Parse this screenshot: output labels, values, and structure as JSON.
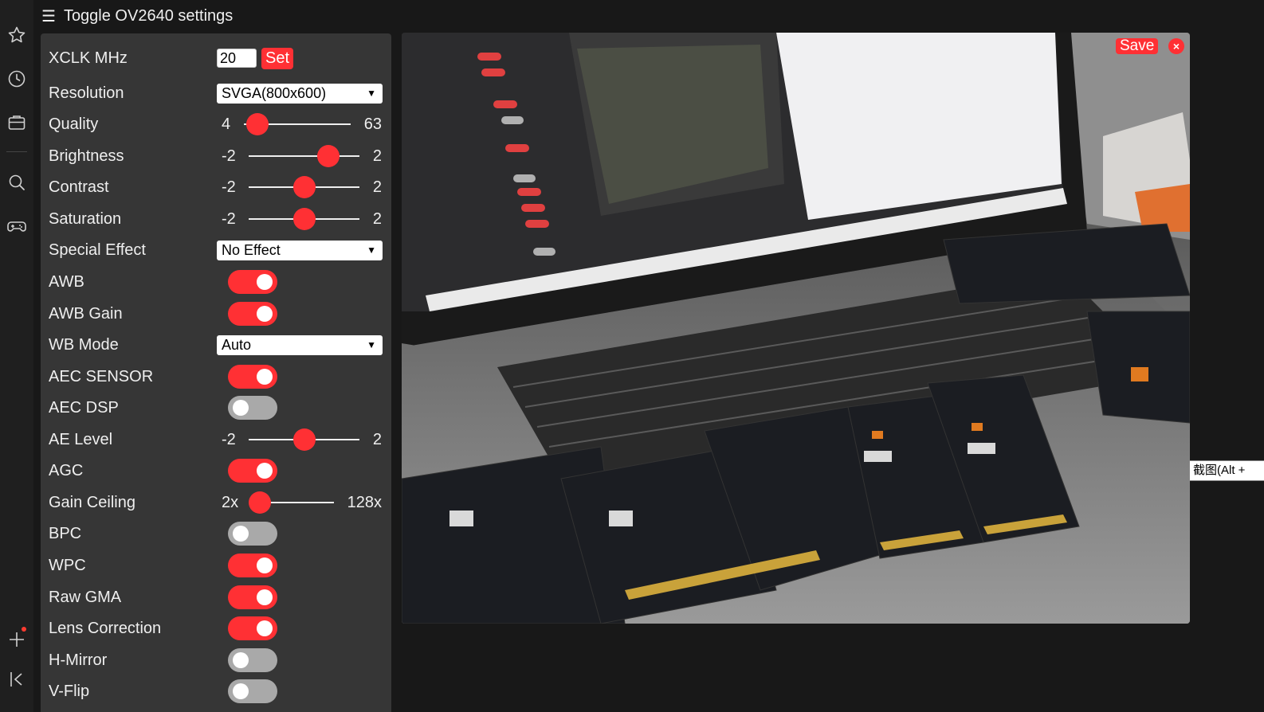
{
  "toggle_label": "Toggle OV2640 settings",
  "settings": {
    "xclk": {
      "label": "XCLK MHz",
      "value": "20",
      "button": "Set"
    },
    "resolution": {
      "label": "Resolution",
      "selected": "SVGA(800x600)"
    },
    "quality": {
      "label": "Quality",
      "min": "4",
      "max": "63",
      "level": 0.08
    },
    "brightness": {
      "label": "Brightness",
      "min": "-2",
      "max": "2",
      "level": 0.75
    },
    "contrast": {
      "label": "Contrast",
      "min": "-2",
      "max": "2",
      "level": 0.5
    },
    "saturation": {
      "label": "Saturation",
      "min": "-2",
      "max": "2",
      "level": 0.5
    },
    "special_effect": {
      "label": "Special Effect",
      "selected": "No Effect"
    },
    "awb": {
      "label": "AWB",
      "on": true
    },
    "awb_gain": {
      "label": "AWB Gain",
      "on": true
    },
    "wb_mode": {
      "label": "WB Mode",
      "selected": "Auto"
    },
    "aec_sensor": {
      "label": "AEC SENSOR",
      "on": true
    },
    "aec_dsp": {
      "label": "AEC DSP",
      "on": false
    },
    "ae_level": {
      "label": "AE Level",
      "min": "-2",
      "max": "2",
      "level": 0.5
    },
    "agc": {
      "label": "AGC",
      "on": true
    },
    "gain_ceiling": {
      "label": "Gain Ceiling",
      "min": "2x",
      "max": "128x",
      "level": 0.0
    },
    "bpc": {
      "label": "BPC",
      "on": false
    },
    "wpc": {
      "label": "WPC",
      "on": true
    },
    "raw_gma": {
      "label": "Raw GMA",
      "on": true
    },
    "lens_correction": {
      "label": "Lens Correction",
      "on": true
    },
    "hmirror": {
      "label": "H-Mirror",
      "on": false
    },
    "vflip": {
      "label": "V-Flip",
      "on": false
    }
  },
  "stream": {
    "save_label": "Save",
    "close_glyph": "×"
  },
  "tooltip": "截图(Alt +",
  "sidebar_icons": [
    "star-icon",
    "history-icon",
    "wallet-icon",
    "search-icon",
    "gamepad-icon",
    "add-icon",
    "collapse-icon"
  ],
  "colors": {
    "accent": "#ff3034",
    "panel": "#363636",
    "background": "#181818"
  }
}
